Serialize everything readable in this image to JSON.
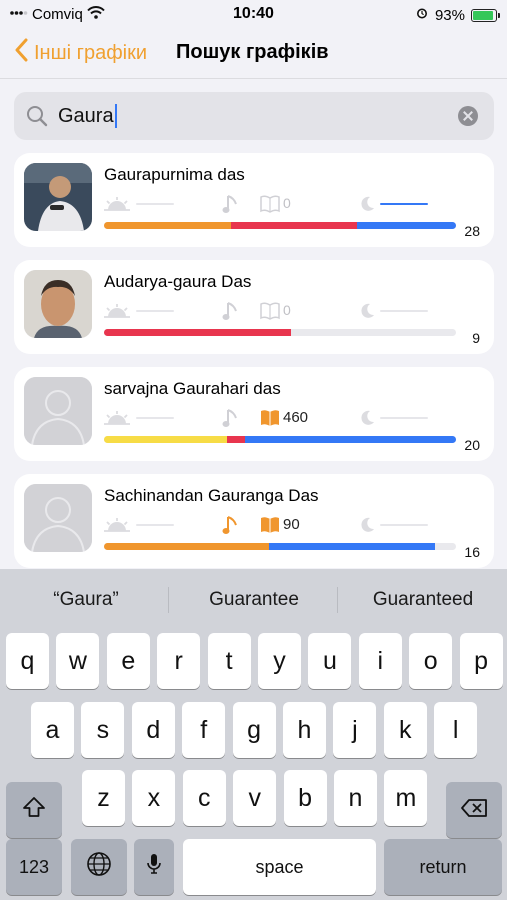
{
  "status_bar": {
    "carrier": "Comviq",
    "time": "10:40",
    "battery_percent": "93%"
  },
  "nav": {
    "back_label": "Інші графіки",
    "title": "Пошук графіків"
  },
  "search": {
    "value": "Gaura"
  },
  "results": [
    {
      "name": "Gaurapurnima das",
      "book_count": "0",
      "total": "28",
      "progress": [
        {
          "color": "#f0962e",
          "fraction": 0.36
        },
        {
          "color": "#e8354e",
          "fraction": 0.36
        },
        {
          "color": "#3478f6",
          "fraction": 0.28
        }
      ]
    },
    {
      "name": "Audarya-gaura Das",
      "book_count": "0",
      "total": "9",
      "progress": [
        {
          "color": "#e8354e",
          "fraction": 0.53
        }
      ]
    },
    {
      "name": "sarvajna Gaurahari das",
      "book_count": "460",
      "total": "20",
      "progress": [
        {
          "color": "#f7dc46",
          "fraction": 0.35
        },
        {
          "color": "#e8354e",
          "fraction": 0.05
        },
        {
          "color": "#3478f6",
          "fraction": 0.6
        }
      ]
    },
    {
      "name": "Sachinandan Gauranga Das",
      "book_count": "90",
      "total": "16",
      "progress": [
        {
          "color": "#f0962e",
          "fraction": 0.47
        },
        {
          "color": "#3478f6",
          "fraction": 0.47
        }
      ]
    }
  ],
  "keyboard": {
    "suggestions": [
      "“Gaura”",
      "Guarantee",
      "Guaranteed"
    ],
    "row1": [
      "q",
      "w",
      "e",
      "r",
      "t",
      "y",
      "u",
      "i",
      "o",
      "p"
    ],
    "row2": [
      "a",
      "s",
      "d",
      "f",
      "g",
      "h",
      "j",
      "k",
      "l"
    ],
    "row3": [
      "z",
      "x",
      "c",
      "v",
      "b",
      "n",
      "m"
    ],
    "numbers_label": "123",
    "space_label": "space",
    "return_label": "return"
  },
  "colors": {
    "accent": "#f0a030",
    "orange": "#f0962e",
    "red": "#e8354e",
    "blue": "#3478f6",
    "yellow": "#f7dc46"
  }
}
